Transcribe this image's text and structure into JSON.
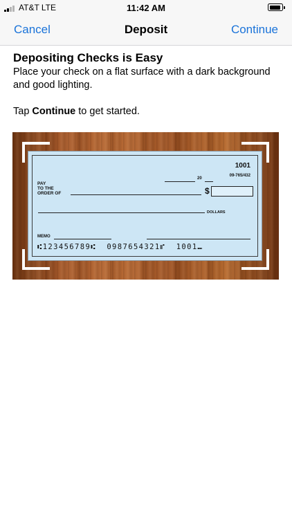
{
  "status_bar": {
    "carrier": "AT&T  LTE",
    "time": "11:42 AM"
  },
  "nav": {
    "cancel_label": "Cancel",
    "title": "Deposit",
    "continue_label": "Continue",
    "accent_color": "#1a73d9"
  },
  "intro": {
    "heading": "Depositing Checks is Easy",
    "description": "Place your check on a flat surface with a dark background and good lighting.",
    "tip_prefix": "Tap ",
    "tip_bold": "Continue",
    "tip_suffix": " to get started."
  },
  "check": {
    "number": "1001",
    "routing_fraction": "09-765/432",
    "date_year": "20",
    "pay_label": "PAY\nTO THE\nORDER OF",
    "dollar_sign": "$",
    "dollars_label": "DOLLARS",
    "memo_label": "MEMO",
    "micr_line": "⑆123456789⑆  0987654321⑈  1001⑉"
  }
}
